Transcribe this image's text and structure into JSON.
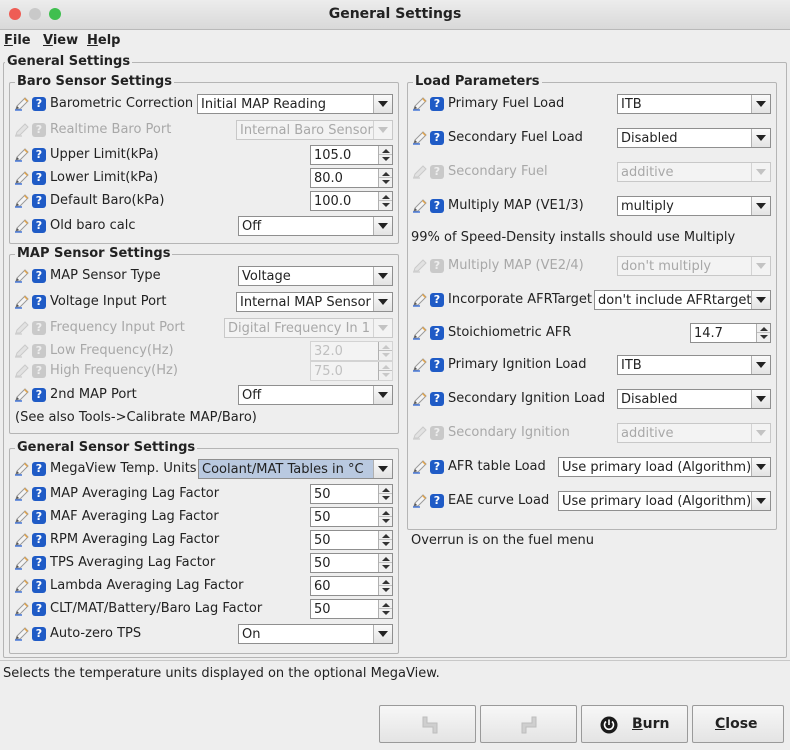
{
  "window": {
    "title": "General Settings"
  },
  "menu": {
    "file": "File",
    "view": "View",
    "help": "Help"
  },
  "panel_title": "General Settings",
  "baro": {
    "title": "Baro Sensor Settings",
    "rows": [
      {
        "label": "Barometric Correction",
        "value": "Initial MAP Reading"
      },
      {
        "label": "Realtime Baro Port",
        "value": "Internal Baro Sensor"
      },
      {
        "label": "Upper Limit(kPa)",
        "value": "105.0"
      },
      {
        "label": "Lower Limit(kPa)",
        "value": "80.0"
      },
      {
        "label": "Default Baro(kPa)",
        "value": "100.0"
      },
      {
        "label": "Old baro calc",
        "value": "Off"
      }
    ]
  },
  "map": {
    "title": "MAP Sensor Settings",
    "rows": [
      {
        "label": "MAP Sensor Type",
        "value": "Voltage"
      },
      {
        "label": "Voltage Input Port",
        "value": "Internal MAP Sensor"
      },
      {
        "label": "Frequency Input Port",
        "value": "Digital Frequency In 1"
      },
      {
        "label": "Low Frequency(Hz)",
        "value": "32.0"
      },
      {
        "label": "High Frequency(Hz)",
        "value": "75.0"
      },
      {
        "label": "2nd MAP Port",
        "value": "Off"
      }
    ],
    "note": "(See also Tools->Calibrate MAP/Baro)"
  },
  "general": {
    "title": "General Sensor Settings",
    "rows": [
      {
        "label": "MegaView Temp. Units",
        "value": "Coolant/MAT Tables in °C"
      },
      {
        "label": "MAP Averaging Lag Factor",
        "value": "50"
      },
      {
        "label": "MAF Averaging Lag Factor",
        "value": "50"
      },
      {
        "label": "RPM Averaging Lag Factor",
        "value": "50"
      },
      {
        "label": "TPS Averaging Lag Factor",
        "value": "50"
      },
      {
        "label": "Lambda Averaging Lag Factor",
        "value": "60"
      },
      {
        "label": "CLT/MAT/Battery/Baro Lag Factor",
        "value": "50"
      },
      {
        "label": "Auto-zero TPS",
        "value": "On"
      }
    ]
  },
  "load": {
    "title": "Load Parameters",
    "rows": [
      {
        "label": "Primary Fuel Load",
        "value": "ITB"
      },
      {
        "label": "Secondary Fuel Load",
        "value": "Disabled"
      },
      {
        "label": "Secondary Fuel",
        "value": "additive"
      },
      {
        "label": "Multiply MAP (VE1/3)",
        "value": "multiply"
      },
      {
        "label": "Multiply MAP (VE2/4)",
        "value": "don't multiply"
      },
      {
        "label": "Incorporate AFRTarget",
        "value": "don't include AFRtarget"
      },
      {
        "label": "Stoichiometric AFR",
        "value": "14.7"
      },
      {
        "label": "Primary Ignition Load",
        "value": "ITB"
      },
      {
        "label": "Secondary Ignition Load",
        "value": "Disabled"
      },
      {
        "label": "Secondary Ignition",
        "value": "additive"
      },
      {
        "label": "AFR table Load",
        "value": "Use primary load (Algorithm)"
      },
      {
        "label": "EAE curve Load",
        "value": "Use primary load (Algorithm)"
      }
    ],
    "note": "99% of Speed-Density installs should use Multiply"
  },
  "overrun_note": "Overrun is on the fuel menu",
  "status_text": "Selects the temperature units displayed on the optional MegaView.",
  "buttons": {
    "burn": "Burn",
    "close": "Close"
  },
  "icons": {
    "edit": "pencil-icon",
    "help": "help-icon",
    "undo": "undo-icon",
    "redo": "redo-icon",
    "burn": "power-icon"
  },
  "colors": {
    "help_icon": "#1f5bc6",
    "selected_combo": "#b9c9e0"
  }
}
